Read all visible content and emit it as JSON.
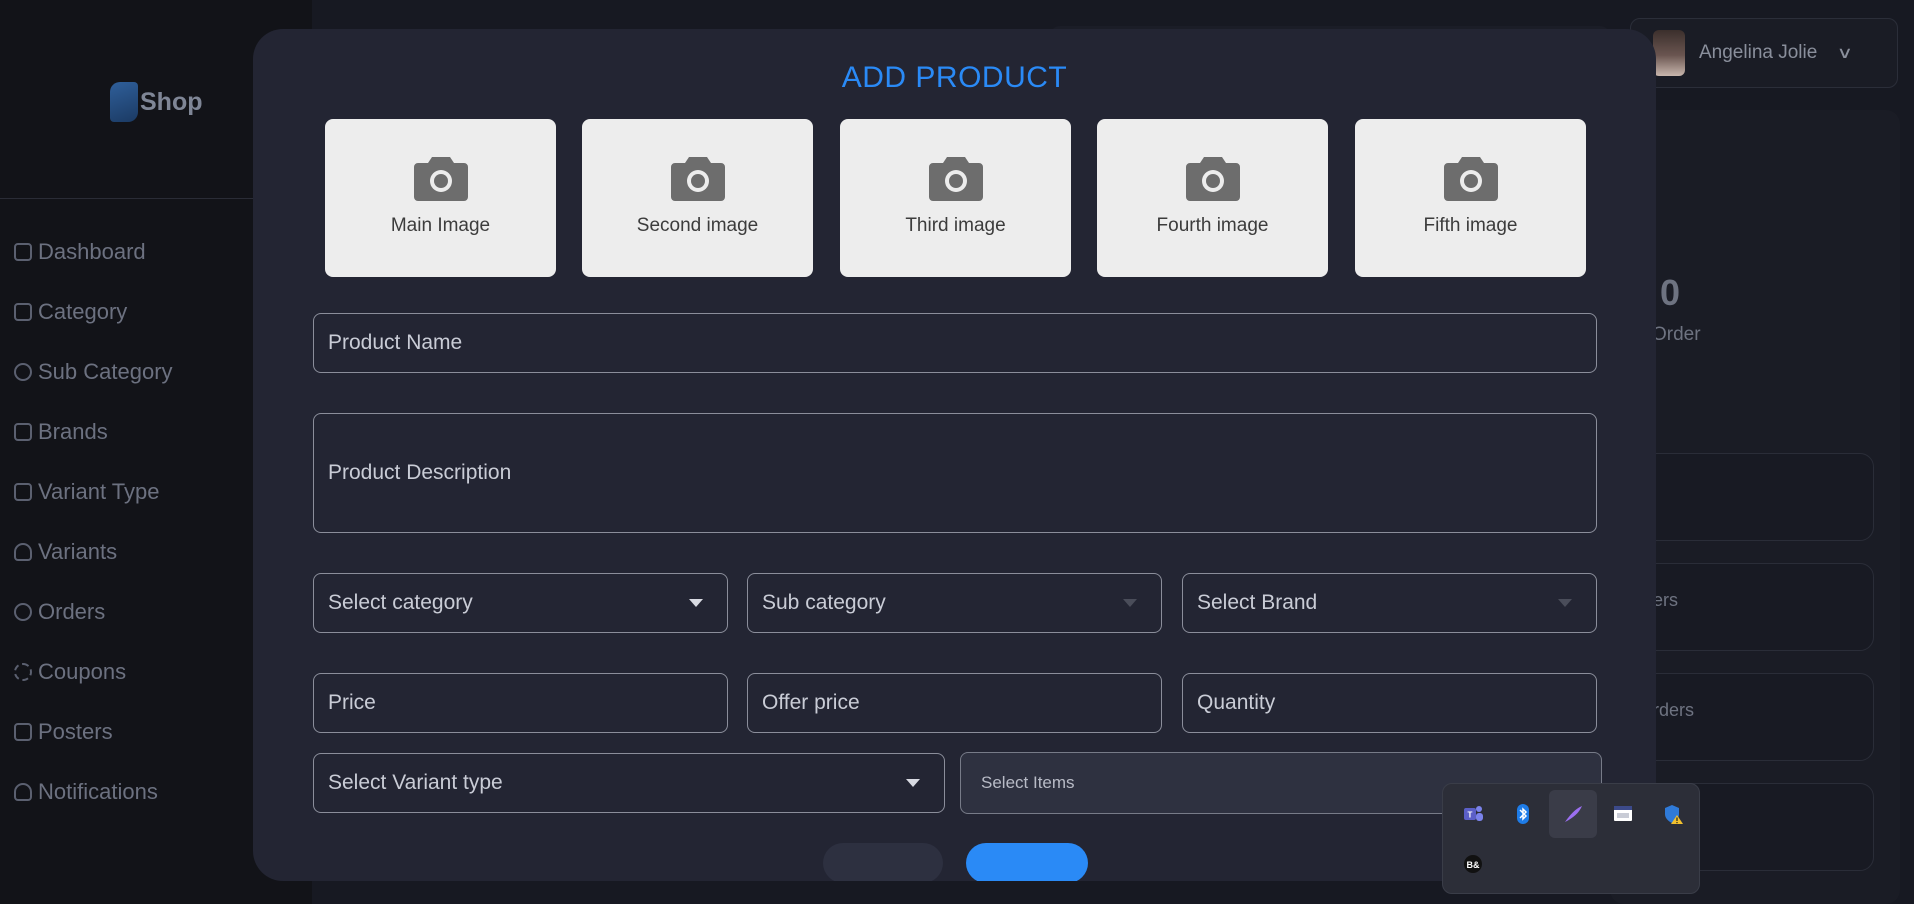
{
  "sidebar": {
    "logo_text": "Shop",
    "items": [
      {
        "label": "Dashboard"
      },
      {
        "label": "Category"
      },
      {
        "label": "Sub Category"
      },
      {
        "label": "Brands"
      },
      {
        "label": "Variant Type"
      },
      {
        "label": "Variants"
      },
      {
        "label": "Orders"
      },
      {
        "label": "Coupons"
      },
      {
        "label": "Posters"
      },
      {
        "label": "Notifications"
      }
    ]
  },
  "header": {
    "user_name": "Angelina Jolie"
  },
  "stats": {
    "count": "0",
    "label": "Order",
    "cards": [
      {
        "label": ""
      },
      {
        "label": "ers"
      },
      {
        "label": "rders"
      },
      {
        "label": ""
      }
    ]
  },
  "modal": {
    "title": "ADD PRODUCT",
    "images": [
      {
        "label": "Main Image"
      },
      {
        "label": "Second image"
      },
      {
        "label": "Third image"
      },
      {
        "label": "Fourth image"
      },
      {
        "label": "Fifth image"
      }
    ],
    "product_name_placeholder": "Product Name",
    "product_description_placeholder": "Product Description",
    "category_placeholder": "Select category",
    "sub_category_placeholder": "Sub category",
    "brand_placeholder": "Select Brand",
    "price_placeholder": "Price",
    "offer_price_placeholder": "Offer price",
    "quantity_placeholder": "Quantity",
    "variant_type_placeholder": "Select Variant type",
    "select_items_placeholder": "Select Items"
  },
  "colors": {
    "accent": "#2a8af6",
    "modal_bg": "#232533",
    "image_box_bg": "#ededed"
  },
  "tray": {
    "icons": [
      "teams-icon",
      "bluetooth-icon",
      "feather-pen-icon",
      "window-app-icon",
      "security-shield-warning-icon",
      "bo-app-icon"
    ]
  }
}
